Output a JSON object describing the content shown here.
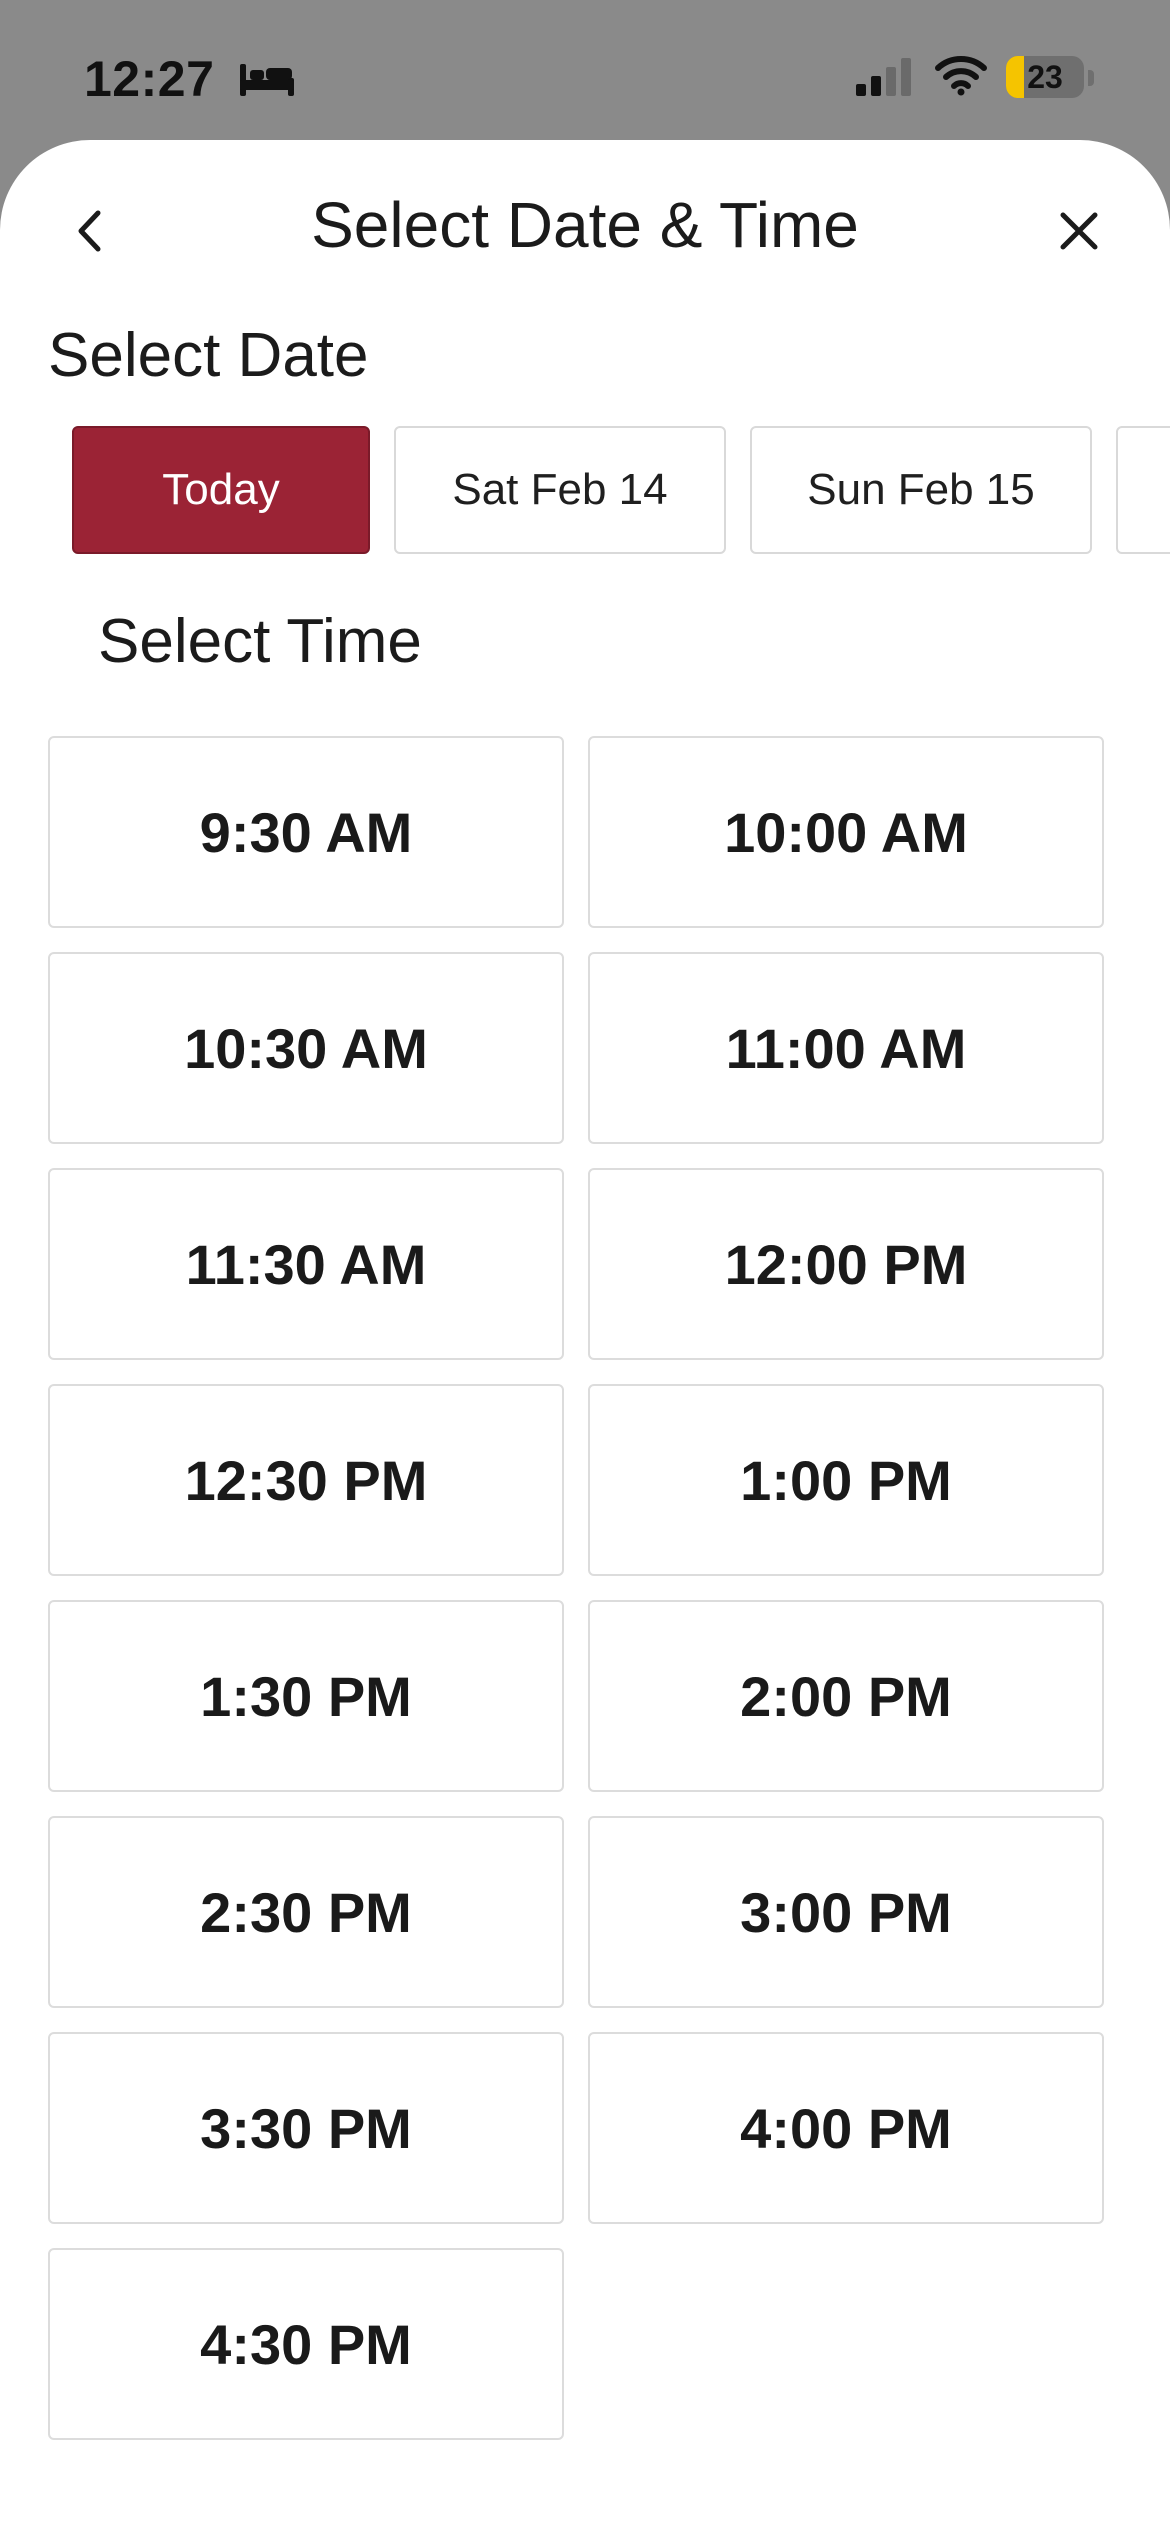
{
  "status_bar": {
    "time": "12:27",
    "battery_level": "23",
    "battery_fraction": 0.23,
    "icons": [
      "bed-icon",
      "signal-icon",
      "wifi-icon",
      "battery-icon"
    ]
  },
  "header": {
    "title": "Select Date & Time",
    "back_icon": "chevron-left-icon",
    "close_icon": "close-icon"
  },
  "date_section": {
    "label": "Select Date",
    "dates": [
      {
        "label": "Today",
        "selected": true
      },
      {
        "label": "Sat Feb 14",
        "selected": false
      },
      {
        "label": "Sun Feb 15",
        "selected": false
      },
      {
        "label": "",
        "selected": false
      }
    ]
  },
  "time_section": {
    "label": "Select Time",
    "slots": [
      "9:30 AM",
      "10:00 AM",
      "10:30 AM",
      "11:00 AM",
      "11:30 AM",
      "12:00 PM",
      "12:30 PM",
      "1:00 PM",
      "1:30 PM",
      "2:00 PM",
      "2:30 PM",
      "3:00 PM",
      "3:30 PM",
      "4:00 PM",
      "4:30 PM"
    ]
  },
  "colors": {
    "accent": "#9b2335",
    "backdrop": "#8a8a8a",
    "battery": "#f5c400"
  }
}
